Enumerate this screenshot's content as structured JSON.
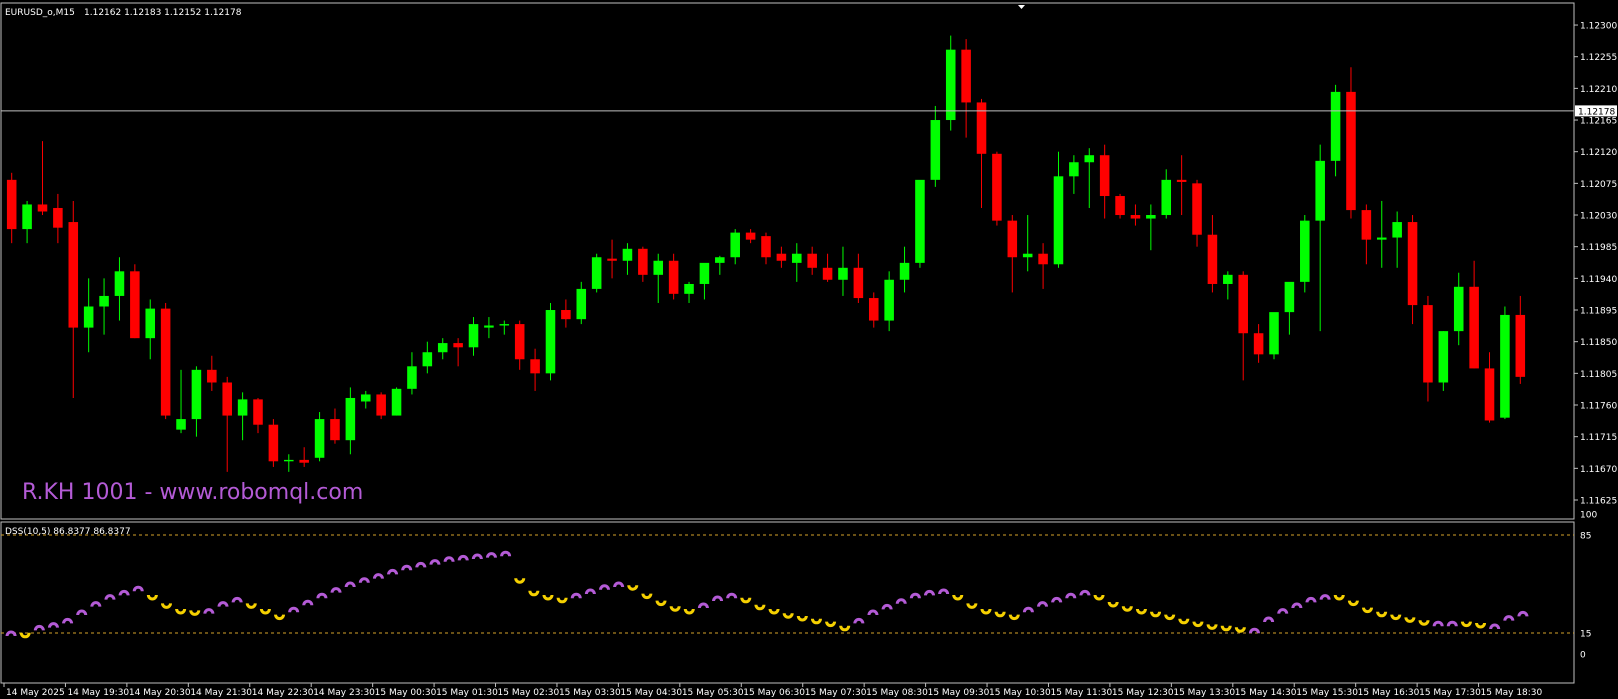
{
  "colors": {
    "background": "#000000",
    "bull": "#00ff00",
    "bear": "#ff0000",
    "grid_border": "#c0c0c0",
    "level_line": "#d4a22a",
    "dss_up": "#b45bd6",
    "dss_down": "#f5d000",
    "watermark": "#b45bd6"
  },
  "main_header": {
    "symbol_label": "EURUSD_o,M15",
    "ohlc_label": "1.12162 1.12183 1.12152 1.12178"
  },
  "watermark": "R.KH 1001 - www.robomql.com",
  "price_axis_labels": [
    "1.12300",
    "1.12255",
    "1.12210",
    "1.12165",
    "1.12120",
    "1.12075",
    "1.12030",
    "1.11985",
    "1.11940",
    "1.11895",
    "1.11850",
    "1.11805",
    "1.11760",
    "1.11715",
    "1.11670",
    "1.11625"
  ],
  "current_price_label": "1.12178",
  "indicator_header": {
    "name_label": "DSS(10,5) 86.8377 86.8377"
  },
  "indicator_axis_labels": [
    "100",
    "85",
    "15",
    "0"
  ],
  "time_labels": [
    "14 May 2025",
    "14 May 19:30",
    "14 May 20:30",
    "14 May 21:30",
    "14 May 22:30",
    "14 May 23:30",
    "15 May 00:30",
    "15 May 01:30",
    "15 May 02:30",
    "15 May 03:30",
    "15 May 04:30",
    "15 May 05:30",
    "15 May 06:30",
    "15 May 07:30",
    "15 May 08:30",
    "15 May 09:30",
    "15 May 10:30",
    "15 May 11:30",
    "15 May 12:30",
    "15 May 13:30",
    "15 May 14:30",
    "15 May 15:30",
    "15 May 16:30",
    "15 May 17:30",
    "15 May 18:30"
  ],
  "chart_data": [
    {
      "type": "candlestick",
      "symbol": "EURUSD_o",
      "timeframe": "M15",
      "ylim": [
        1.11625,
        1.1231
      ],
      "current_price": 1.12178,
      "candles": [
        {
          "o": 1.1208,
          "h": 1.1209,
          "l": 1.1199,
          "c": 1.1201
        },
        {
          "o": 1.1201,
          "h": 1.1205,
          "l": 1.1199,
          "c": 1.12045
        },
        {
          "o": 1.12045,
          "h": 1.12135,
          "l": 1.1203,
          "c": 1.12035
        },
        {
          "o": 1.1204,
          "h": 1.1206,
          "l": 1.1199,
          "c": 1.12012
        },
        {
          "o": 1.1202,
          "h": 1.1205,
          "l": 1.1177,
          "c": 1.1187
        },
        {
          "o": 1.1187,
          "h": 1.1194,
          "l": 1.11835,
          "c": 1.119
        },
        {
          "o": 1.119,
          "h": 1.1194,
          "l": 1.1186,
          "c": 1.11915
        },
        {
          "o": 1.11915,
          "h": 1.1197,
          "l": 1.1188,
          "c": 1.1195
        },
        {
          "o": 1.1195,
          "h": 1.1196,
          "l": 1.11855,
          "c": 1.11855
        },
        {
          "o": 1.11855,
          "h": 1.1191,
          "l": 1.11825,
          "c": 1.11897
        },
        {
          "o": 1.11897,
          "h": 1.11905,
          "l": 1.1174,
          "c": 1.11745
        },
        {
          "o": 1.11725,
          "h": 1.1181,
          "l": 1.1172,
          "c": 1.1174
        },
        {
          "o": 1.1174,
          "h": 1.11815,
          "l": 1.11715,
          "c": 1.1181
        },
        {
          "o": 1.1181,
          "h": 1.1183,
          "l": 1.1178,
          "c": 1.11792
        },
        {
          "o": 1.11792,
          "h": 1.118,
          "l": 1.11665,
          "c": 1.11745
        },
        {
          "o": 1.11745,
          "h": 1.11778,
          "l": 1.1171,
          "c": 1.11768
        },
        {
          "o": 1.11768,
          "h": 1.1177,
          "l": 1.1172,
          "c": 1.11732
        },
        {
          "o": 1.11732,
          "h": 1.1174,
          "l": 1.11672,
          "c": 1.1168
        },
        {
          "o": 1.1168,
          "h": 1.1169,
          "l": 1.11665,
          "c": 1.11682
        },
        {
          "o": 1.11682,
          "h": 1.117,
          "l": 1.11672,
          "c": 1.11678
        },
        {
          "o": 1.11685,
          "h": 1.1175,
          "l": 1.1168,
          "c": 1.1174
        },
        {
          "o": 1.1174,
          "h": 1.11755,
          "l": 1.11705,
          "c": 1.1171
        },
        {
          "o": 1.1171,
          "h": 1.11785,
          "l": 1.1169,
          "c": 1.1177
        },
        {
          "o": 1.11765,
          "h": 1.1178,
          "l": 1.11755,
          "c": 1.11775
        },
        {
          "o": 1.11775,
          "h": 1.11778,
          "l": 1.1174,
          "c": 1.11745
        },
        {
          "o": 1.11745,
          "h": 1.11785,
          "l": 1.11745,
          "c": 1.11783
        },
        {
          "o": 1.11783,
          "h": 1.11835,
          "l": 1.11775,
          "c": 1.11815
        },
        {
          "o": 1.11815,
          "h": 1.1185,
          "l": 1.11805,
          "c": 1.11835
        },
        {
          "o": 1.11835,
          "h": 1.11855,
          "l": 1.11825,
          "c": 1.11848
        },
        {
          "o": 1.11848,
          "h": 1.11855,
          "l": 1.11815,
          "c": 1.11842
        },
        {
          "o": 1.11842,
          "h": 1.11885,
          "l": 1.1183,
          "c": 1.11875
        },
        {
          "o": 1.1187,
          "h": 1.11885,
          "l": 1.11855,
          "c": 1.11873
        },
        {
          "o": 1.11873,
          "h": 1.1188,
          "l": 1.1186,
          "c": 1.11875
        },
        {
          "o": 1.11875,
          "h": 1.1188,
          "l": 1.1181,
          "c": 1.11825
        },
        {
          "o": 1.11825,
          "h": 1.1184,
          "l": 1.1178,
          "c": 1.11805
        },
        {
          "o": 1.11805,
          "h": 1.11905,
          "l": 1.11795,
          "c": 1.11895
        },
        {
          "o": 1.11895,
          "h": 1.1191,
          "l": 1.1187,
          "c": 1.11882
        },
        {
          "o": 1.11882,
          "h": 1.11935,
          "l": 1.11875,
          "c": 1.11925
        },
        {
          "o": 1.11925,
          "h": 1.11975,
          "l": 1.1192,
          "c": 1.1197
        },
        {
          "o": 1.11968,
          "h": 1.11995,
          "l": 1.1194,
          "c": 1.11965
        },
        {
          "o": 1.11965,
          "h": 1.1199,
          "l": 1.11945,
          "c": 1.11982
        },
        {
          "o": 1.11982,
          "h": 1.11985,
          "l": 1.11935,
          "c": 1.11945
        },
        {
          "o": 1.11945,
          "h": 1.11975,
          "l": 1.11905,
          "c": 1.11965
        },
        {
          "o": 1.11965,
          "h": 1.11975,
          "l": 1.1191,
          "c": 1.11918
        },
        {
          "o": 1.11918,
          "h": 1.11935,
          "l": 1.11905,
          "c": 1.11932
        },
        {
          "o": 1.11932,
          "h": 1.1196,
          "l": 1.1191,
          "c": 1.11962
        },
        {
          "o": 1.11962,
          "h": 1.11972,
          "l": 1.11945,
          "c": 1.1197
        },
        {
          "o": 1.1197,
          "h": 1.1201,
          "l": 1.1196,
          "c": 1.12005
        },
        {
          "o": 1.12005,
          "h": 1.1201,
          "l": 1.1199,
          "c": 1.11995
        },
        {
          "o": 1.12,
          "h": 1.12005,
          "l": 1.1196,
          "c": 1.1197
        },
        {
          "o": 1.11975,
          "h": 1.11985,
          "l": 1.11955,
          "c": 1.11965
        },
        {
          "o": 1.11962,
          "h": 1.1199,
          "l": 1.11935,
          "c": 1.11975
        },
        {
          "o": 1.11975,
          "h": 1.11985,
          "l": 1.11945,
          "c": 1.11955
        },
        {
          "o": 1.11955,
          "h": 1.11975,
          "l": 1.11935,
          "c": 1.11938
        },
        {
          "o": 1.11938,
          "h": 1.11985,
          "l": 1.11915,
          "c": 1.11955
        },
        {
          "o": 1.11955,
          "h": 1.11975,
          "l": 1.11905,
          "c": 1.11912
        },
        {
          "o": 1.11912,
          "h": 1.1192,
          "l": 1.1187,
          "c": 1.1188
        },
        {
          "o": 1.1188,
          "h": 1.1195,
          "l": 1.11865,
          "c": 1.11938
        },
        {
          "o": 1.11938,
          "h": 1.11985,
          "l": 1.1192,
          "c": 1.11962
        },
        {
          "o": 1.11962,
          "h": 1.12045,
          "l": 1.11955,
          "c": 1.1208
        },
        {
          "o": 1.1208,
          "h": 1.12185,
          "l": 1.1207,
          "c": 1.12165
        },
        {
          "o": 1.12165,
          "h": 1.12285,
          "l": 1.1215,
          "c": 1.12265
        },
        {
          "o": 1.12265,
          "h": 1.1228,
          "l": 1.1214,
          "c": 1.1219
        },
        {
          "o": 1.1219,
          "h": 1.12195,
          "l": 1.1204,
          "c": 1.12117
        },
        {
          "o": 1.12117,
          "h": 1.1212,
          "l": 1.12015,
          "c": 1.12022
        },
        {
          "o": 1.12022,
          "h": 1.1203,
          "l": 1.1192,
          "c": 1.1197
        },
        {
          "o": 1.1197,
          "h": 1.1203,
          "l": 1.1195,
          "c": 1.11975
        },
        {
          "o": 1.11975,
          "h": 1.1199,
          "l": 1.11925,
          "c": 1.1196
        },
        {
          "o": 1.1196,
          "h": 1.1212,
          "l": 1.11955,
          "c": 1.12085
        },
        {
          "o": 1.12085,
          "h": 1.12115,
          "l": 1.1206,
          "c": 1.12105
        },
        {
          "o": 1.12105,
          "h": 1.12125,
          "l": 1.1204,
          "c": 1.12115
        },
        {
          "o": 1.12115,
          "h": 1.1213,
          "l": 1.12025,
          "c": 1.12057
        },
        {
          "o": 1.12057,
          "h": 1.1206,
          "l": 1.12025,
          "c": 1.1203
        },
        {
          "o": 1.1203,
          "h": 1.12045,
          "l": 1.12015,
          "c": 1.12025
        },
        {
          "o": 1.12025,
          "h": 1.12045,
          "l": 1.1198,
          "c": 1.1203
        },
        {
          "o": 1.1203,
          "h": 1.12095,
          "l": 1.12025,
          "c": 1.1208
        },
        {
          "o": 1.1208,
          "h": 1.12115,
          "l": 1.1203,
          "c": 1.12077
        },
        {
          "o": 1.12075,
          "h": 1.1208,
          "l": 1.11985,
          "c": 1.12002
        },
        {
          "o": 1.12002,
          "h": 1.1203,
          "l": 1.1192,
          "c": 1.11932
        },
        {
          "o": 1.11932,
          "h": 1.1195,
          "l": 1.1191,
          "c": 1.11945
        },
        {
          "o": 1.11945,
          "h": 1.1195,
          "l": 1.11795,
          "c": 1.11862
        },
        {
          "o": 1.11862,
          "h": 1.11875,
          "l": 1.1182,
          "c": 1.11832
        },
        {
          "o": 1.11832,
          "h": 1.1189,
          "l": 1.11825,
          "c": 1.11892
        },
        {
          "o": 1.11892,
          "h": 1.11915,
          "l": 1.1186,
          "c": 1.11935
        },
        {
          "o": 1.11935,
          "h": 1.1203,
          "l": 1.1192,
          "c": 1.12022
        },
        {
          "o": 1.12022,
          "h": 1.1213,
          "l": 1.11865,
          "c": 1.12107
        },
        {
          "o": 1.12107,
          "h": 1.12215,
          "l": 1.12085,
          "c": 1.12205
        },
        {
          "o": 1.12205,
          "h": 1.1224,
          "l": 1.12025,
          "c": 1.12037
        },
        {
          "o": 1.12037,
          "h": 1.12045,
          "l": 1.1196,
          "c": 1.11995
        },
        {
          "o": 1.11995,
          "h": 1.1205,
          "l": 1.11955,
          "c": 1.11998
        },
        {
          "o": 1.11998,
          "h": 1.12035,
          "l": 1.11955,
          "c": 1.1202
        },
        {
          "o": 1.1202,
          "h": 1.1203,
          "l": 1.11875,
          "c": 1.11902
        },
        {
          "o": 1.11902,
          "h": 1.11915,
          "l": 1.11765,
          "c": 1.11792
        },
        {
          "o": 1.11792,
          "h": 1.11865,
          "l": 1.1178,
          "c": 1.11865
        },
        {
          "o": 1.11865,
          "h": 1.11948,
          "l": 1.11845,
          "c": 1.11928
        },
        {
          "o": 1.11928,
          "h": 1.11965,
          "l": 1.11812,
          "c": 1.11812
        },
        {
          "o": 1.11812,
          "h": 1.11835,
          "l": 1.11735,
          "c": 1.11738
        },
        {
          "o": 1.11742,
          "h": 1.119,
          "l": 1.1174,
          "c": 1.11888
        },
        {
          "o": 1.11888,
          "h": 1.11915,
          "l": 1.1179,
          "c": 1.118
        }
      ]
    },
    {
      "type": "scatter",
      "name": "DSS(10,5)",
      "ylim": [
        0,
        100
      ],
      "levels": [
        85,
        15
      ],
      "values": [
        15,
        13,
        19,
        21,
        24,
        30,
        36,
        41,
        44,
        47,
        40,
        34,
        30,
        29,
        31,
        36,
        39,
        34,
        30,
        26,
        32,
        37,
        42,
        46,
        50,
        53,
        56,
        59,
        62,
        64,
        66,
        68,
        69,
        70,
        71,
        72,
        52,
        43,
        40,
        38,
        42,
        45,
        48,
        50,
        47,
        41,
        36,
        32,
        30,
        35,
        40,
        42,
        38,
        33,
        30,
        27,
        25,
        23,
        21,
        18,
        24,
        30,
        34,
        38,
        42,
        44,
        45,
        40,
        34,
        30,
        28,
        26,
        32,
        36,
        39,
        42,
        44,
        40,
        35,
        32,
        30,
        28,
        26,
        23,
        21,
        19,
        18,
        17,
        17,
        25,
        31,
        35,
        39,
        41,
        40,
        36,
        31,
        28,
        26,
        24,
        22,
        22,
        22,
        21,
        20,
        20,
        26,
        29
      ]
    }
  ]
}
